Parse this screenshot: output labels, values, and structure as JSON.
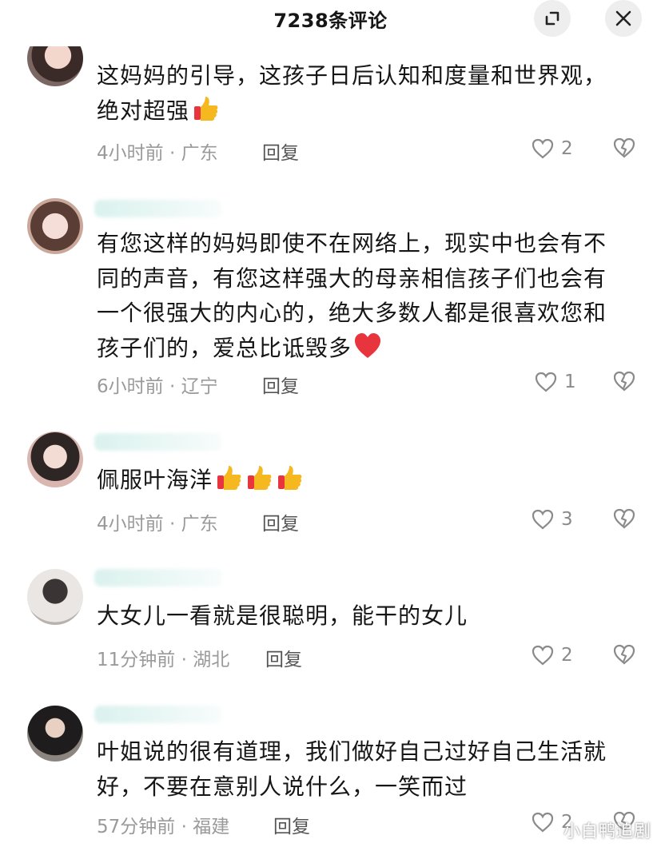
{
  "header": {
    "title": "7238条评论"
  },
  "comments": [
    {
      "text_lines": [
        "这妈妈的引导，这孩子日后认知和度量和世界观，",
        "绝对超强"
      ],
      "time": "4小时前",
      "location": "广东",
      "reply_label": "回复",
      "likes": "2"
    },
    {
      "text_lines": [
        "有您这样的妈妈即使不在网络上，现实中也会有不",
        "同的声音，有您这样强大的母亲相信孩子们也会有",
        "一个很强大的内心的，绝大多数人都是很喜欢您和",
        "孩子们的，爱总比诋毁多"
      ],
      "time": "6小时前",
      "location": "辽宁",
      "reply_label": "回复",
      "likes": "1"
    },
    {
      "text_lines": [
        "佩服叶海洋"
      ],
      "time": "4小时前",
      "location": "广东",
      "reply_label": "回复",
      "likes": "3"
    },
    {
      "text_lines": [
        "大女儿一看就是很聪明，能干的女儿"
      ],
      "time": "11分钟前",
      "location": "湖北",
      "reply_label": "回复",
      "likes": "2"
    },
    {
      "text_lines": [
        "叶姐说的很有道理，我们做好自己过好自己生活就",
        "好，不要在意别人说什么，一笑而过"
      ],
      "time": "57分钟前",
      "location": "福建",
      "reply_label": "回复",
      "likes": "2"
    }
  ],
  "meta_separator": " · ",
  "icons": {
    "collapse": "collapse-icon",
    "close": "close-icon",
    "like": "heart-outline-icon",
    "dislike": "broken-heart-icon",
    "thumbs_up": "thumbs-up-emoji",
    "heart": "red-heart-emoji"
  },
  "watermark": "小白鸭追剧",
  "colors": {
    "meta_gray": "#9a9a9a",
    "emoji_yellow": "#f6b81f",
    "emoji_red": "#e8343d"
  }
}
